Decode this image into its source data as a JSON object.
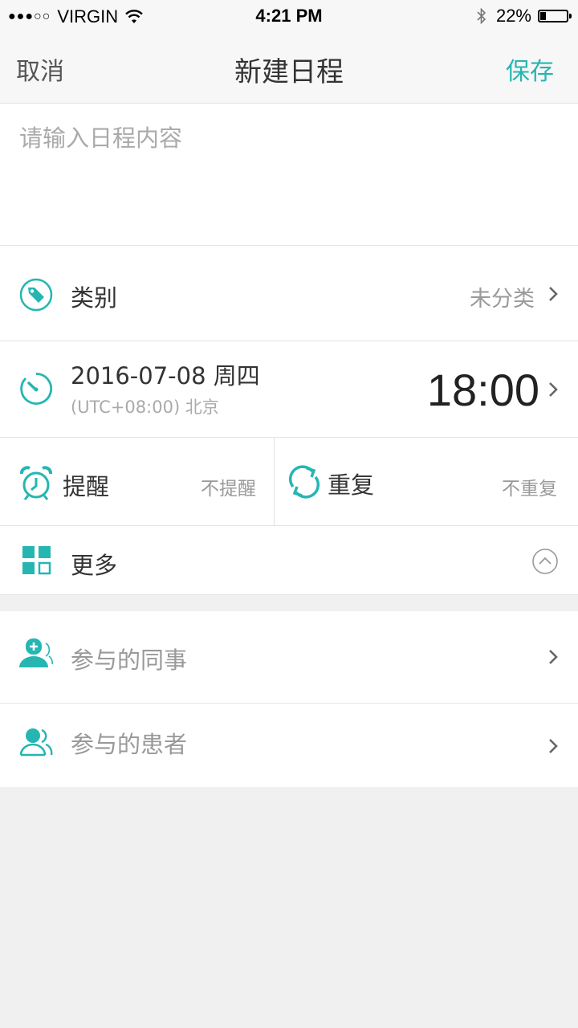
{
  "status_bar": {
    "signal_dots": "●●●○○",
    "carrier": "VIRGIN",
    "time": "4:21 PM",
    "battery": "22%",
    "battery_level": 0.22
  },
  "nav": {
    "cancel": "取消",
    "title": "新建日程",
    "save": "保存"
  },
  "content": {
    "placeholder": "请输入日程内容",
    "value": ""
  },
  "category": {
    "label": "类别",
    "value": "未分类"
  },
  "datetime": {
    "date": "2016-07-08 周四",
    "timezone": "(UTC+08:00) 北京",
    "time": "18:00"
  },
  "reminder": {
    "label": "提醒",
    "value": "不提醒"
  },
  "repeat": {
    "label": "重复",
    "value": "不重复"
  },
  "more": {
    "label": "更多"
  },
  "participants": {
    "colleagues": "参与的同事",
    "patients": "参与的患者"
  },
  "colors": {
    "accent": "#25b6b2",
    "text": "#333333",
    "secondary_text": "#9a9a9a",
    "background": "#f0f0f0"
  }
}
